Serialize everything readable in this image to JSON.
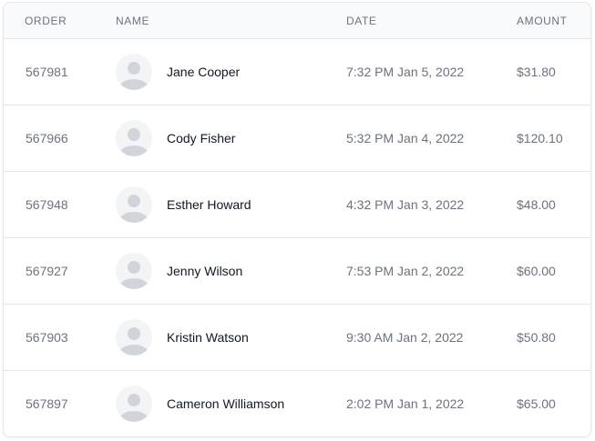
{
  "table": {
    "headers": {
      "order": "ORDER",
      "name": "NAME",
      "date": "DATE",
      "amount": "AMOUNT"
    },
    "rows": [
      {
        "order": "567981",
        "name": "Jane Cooper",
        "date": "7:32 PM Jan 5, 2022",
        "amount": "$31.80",
        "avatar_icon": "user-placeholder-icon"
      },
      {
        "order": "567966",
        "name": "Cody Fisher",
        "date": "5:32 PM Jan 4, 2022",
        "amount": "$120.10",
        "avatar_icon": "user-placeholder-icon"
      },
      {
        "order": "567948",
        "name": "Esther Howard",
        "date": "4:32 PM Jan 3, 2022",
        "amount": "$48.00",
        "avatar_icon": "user-placeholder-icon"
      },
      {
        "order": "567927",
        "name": "Jenny Wilson",
        "date": "7:53 PM Jan 2, 2022",
        "amount": "$60.00",
        "avatar_icon": "user-placeholder-icon"
      },
      {
        "order": "567903",
        "name": "Kristin Watson",
        "date": "9:30 AM Jan 2, 2022",
        "amount": "$50.80",
        "avatar_icon": "user-placeholder-icon"
      },
      {
        "order": "567897",
        "name": "Cameron Williamson",
        "date": "2:02 PM Jan 1, 2022",
        "amount": "$65.00",
        "avatar_icon": "user-placeholder-icon"
      }
    ]
  },
  "colors": {
    "header_bg": "#f9fafb",
    "border": "#e5e7eb",
    "text_primary": "#111827",
    "text_secondary": "#6b7280",
    "avatar_bg": "#f3f4f6",
    "avatar_fg": "#d1d5db"
  }
}
